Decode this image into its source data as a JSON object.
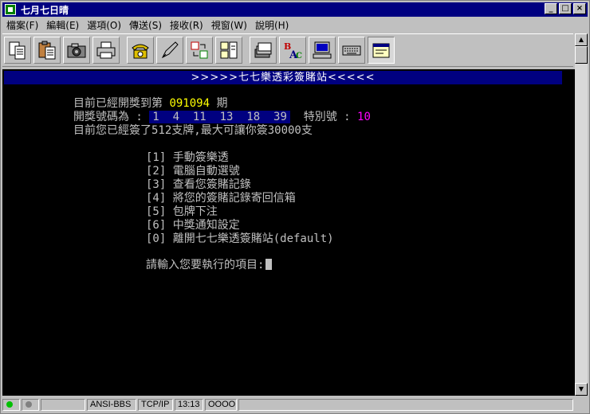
{
  "window": {
    "title": "七月七日晴"
  },
  "menu": [
    "檔案(F)",
    "編輯(E)",
    "選項(O)",
    "傳送(S)",
    "接收(R)",
    "視窗(W)",
    "說明(H)"
  ],
  "toolbar": [
    "copy",
    "paste",
    "camera",
    "print",
    "phone",
    "pen",
    "swap",
    "document",
    "stack",
    "spell-check",
    "computer",
    "keyboard",
    "note"
  ],
  "terminal": {
    "banner": ">>>>>七七樂透彩簽賭站<<<<<",
    "draw_prefix": "目前已經開獎到第 ",
    "draw_no": "091094",
    "draw_suffix": " 期",
    "numbers_label": "開獎號碼為 : ",
    "numbers": "1  4  11  13  18  39",
    "special_label": "  特別號 : ",
    "special": "10",
    "quota": "目前您已經簽了512支牌,最大可讓你簽30000支",
    "options": [
      "[1] 手動簽樂透",
      "[2] 電腦自動選號",
      "[3] 查看您簽賭記錄",
      "[4] 將您的簽賭記錄寄回信箱",
      "[5] 包牌下注",
      "[6] 中獎通知設定",
      "[0] 離開七七樂透簽賭站(default)"
    ],
    "prompt": "請輸入您要執行的項目:"
  },
  "status": {
    "terminal_type": "ANSI-BBS",
    "protocol": "TCP/IP",
    "time": "13:13",
    "leds": "OOOO"
  },
  "colors": {
    "title_blue": "#000080",
    "highlight_yellow": "#ffff00",
    "special_magenta": "#ff00ff",
    "led_green": "#00c000"
  }
}
